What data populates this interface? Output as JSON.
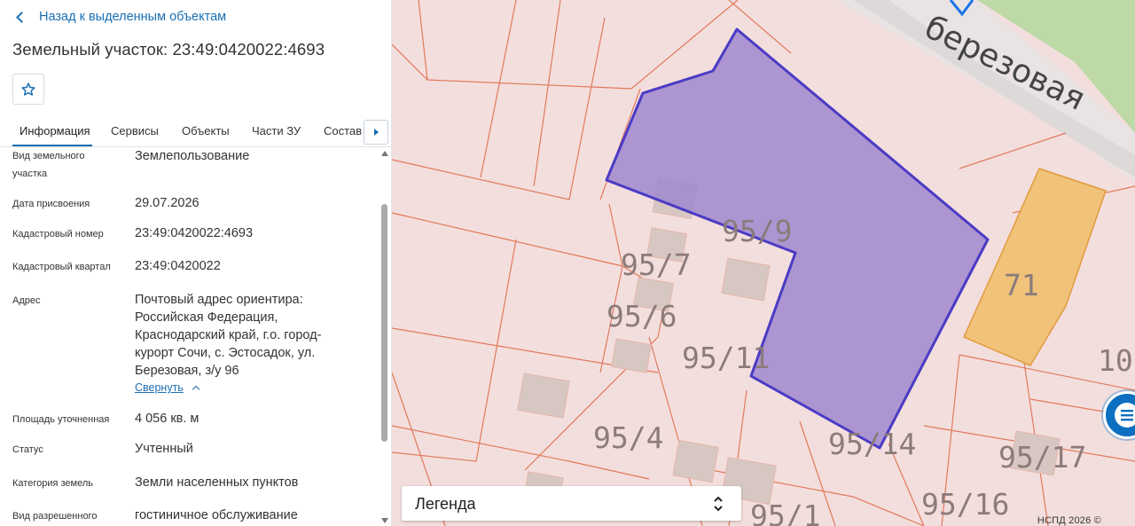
{
  "panel": {
    "back_label": "Назад к выделенным объектам",
    "title": "Земельный участок: 23:49:0420022:4693",
    "favorite_icon": "star-icon",
    "tabs": [
      {
        "label": "Информация",
        "active": true
      },
      {
        "label": "Сервисы",
        "active": false
      },
      {
        "label": "Объекты",
        "active": false
      },
      {
        "label": "Части ЗУ",
        "active": false
      },
      {
        "label": "Состав",
        "active": false
      }
    ],
    "tabs_next_icon": "caret-right-icon",
    "fields": [
      {
        "label": "Вид земельного участка",
        "value": "Землепользование"
      },
      {
        "label": "Дата присвоения",
        "value": "29.07.2026"
      },
      {
        "label": "Кадастровый номер",
        "value": "23:49:0420022:4693"
      },
      {
        "label": "Кадастровый квартал",
        "value": "23:49:0420022"
      },
      {
        "label": "Адрес",
        "value": "Почтовый адрес ориентира: Российская Федерация, Краснодарский край, г.о. город-курорт Сочи, с. Эстосадок, ул. Березовая, з/у 96"
      },
      {
        "label": "Площадь уточненная",
        "value": "4 056 кв. м"
      },
      {
        "label": "Статус",
        "value": "Учтенный"
      },
      {
        "label": "Категория земель",
        "value": "Земли населенных пунктов"
      },
      {
        "label": "Вид разрешенного",
        "value": "гостиничное обслуживание"
      }
    ],
    "address_lines": [
      "Почтовый адрес ориентира:",
      "Российская Федерация,",
      "Краснодарский край, г.о. город-",
      "курорт Сочи, с. Эстосадок, ул.",
      "Березовая, з/у 96"
    ],
    "label_wrap": {
      "line1": "Вид земельного",
      "line2": "участка"
    },
    "collapse_label": "Свернуть"
  },
  "map": {
    "street_label": "Березовая ул.",
    "street_label_visible": "березовая",
    "parcel_labels": [
      "95/9",
      "95/7",
      "95/6",
      "95/11",
      "95/4",
      "95/14",
      "95/17",
      "95/16",
      "95/1",
      "71",
      "10"
    ],
    "legend_label": "Легенда",
    "copyright": "НСПД 2026 ©",
    "colors": {
      "background": "#f3dede",
      "parcel_line": "#e07a5a",
      "selected_fill": "#9f88cf",
      "selected_stroke": "#4b3bc4",
      "building_fill": "#f0c27a",
      "building_stroke": "#e39a3c",
      "green_area": "#bcd9a6",
      "chat_button": "#0d6fc0"
    }
  }
}
